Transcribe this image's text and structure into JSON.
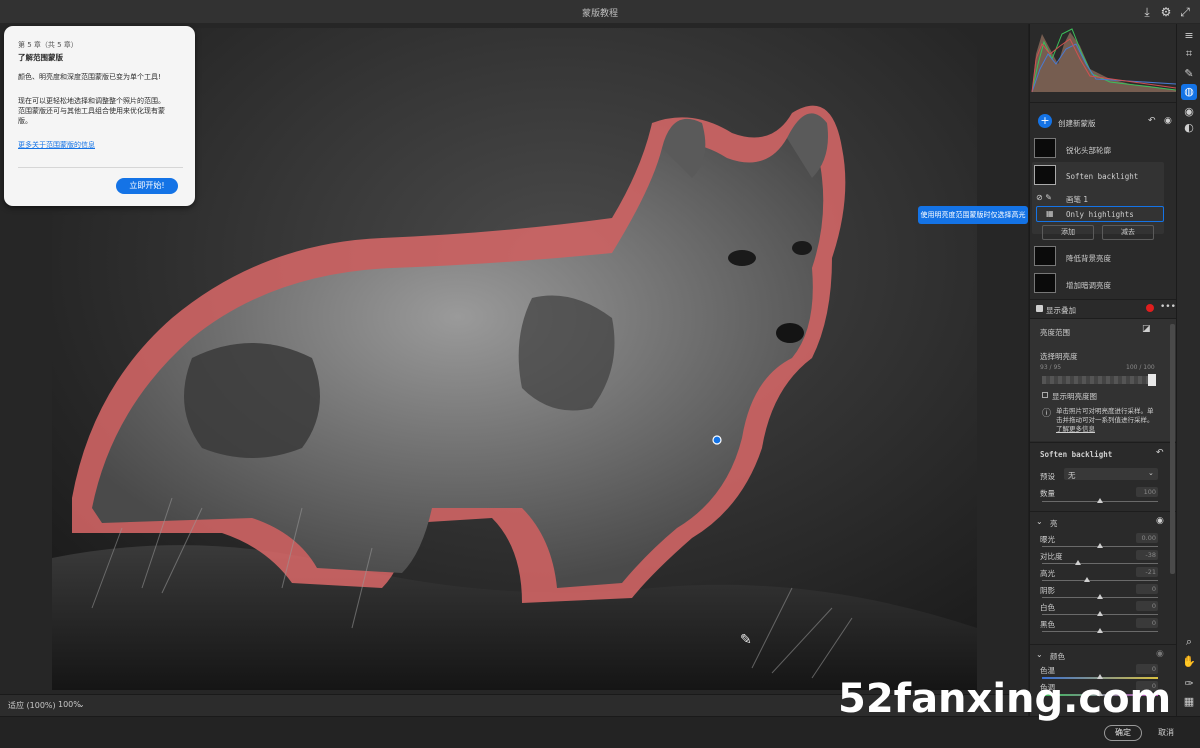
{
  "app": {
    "title": "蒙版教程"
  },
  "tutorial": {
    "chapter": "第 5 章（共 5 章）",
    "heading": "了解范围蒙版",
    "lines": [
      "颜色、明亮度和深度范围蒙版已变为单个工具!",
      "现在可以更轻松地选择和调整整个照片的范围。",
      "范围蒙版还可与其他工具组合使用来优化现有蒙",
      "版。"
    ],
    "link": "更多关于范围蒙版的信息",
    "start_button": "立即开始!"
  },
  "tooltip": {
    "text": "使用明亮度范围蒙版时仅选择高光"
  },
  "masks": {
    "create_label": "创建新蒙版",
    "items": [
      {
        "label": "锐化头部轮廓"
      },
      {
        "label": "Soften backlight"
      },
      {
        "label": "画笔 1"
      },
      {
        "label": "Only highlights"
      },
      {
        "label": "降低背景亮度"
      },
      {
        "label": "增加暗调亮度"
      }
    ],
    "add_label": "添加",
    "subtract_label": "减去",
    "show_overlay": "显示叠加"
  },
  "range": {
    "title": "亮度范围",
    "select_label": "选择明亮度",
    "left_values": "93 / 95",
    "right_values": "100 / 100",
    "show_map": "显示明亮度图",
    "info_lines": [
      "单击照片可对明亮度进行采样。单",
      "击并拖动可对一系列值进行采样。"
    ],
    "info_link": "了解更多信息"
  },
  "adjust": {
    "name": "Soften backlight",
    "preset_label": "预设",
    "preset_value": "无",
    "amount_label": "数量",
    "amount_value": "100"
  },
  "light": {
    "title": "亮",
    "sliders": [
      {
        "label": "曝光",
        "value": "0.00",
        "level": 0.5
      },
      {
        "label": "对比度",
        "value": "-38",
        "level": 0.31
      },
      {
        "label": "高光",
        "value": "-21",
        "level": 0.39
      },
      {
        "label": "阴影",
        "value": "0",
        "level": 0.5
      },
      {
        "label": "白色",
        "value": "0",
        "level": 0.5
      },
      {
        "label": "黑色",
        "value": "0",
        "level": 0.5
      }
    ]
  },
  "color": {
    "title": "颜色",
    "sliders": [
      {
        "label": "色温",
        "value": "0",
        "level": 0.5
      },
      {
        "label": "色调",
        "value": "0",
        "level": 0.5
      }
    ]
  },
  "bottom": {
    "fit_label": "适应 (100%)",
    "zoom_label": "100%"
  },
  "footer": {
    "ok": "确定",
    "cancel": "取消"
  },
  "watermark": {
    "text": "52fanxing.com"
  },
  "colors": {
    "accent": "#1473e6",
    "overlay": "#e06a6a",
    "panel": "#2a2a2a"
  }
}
